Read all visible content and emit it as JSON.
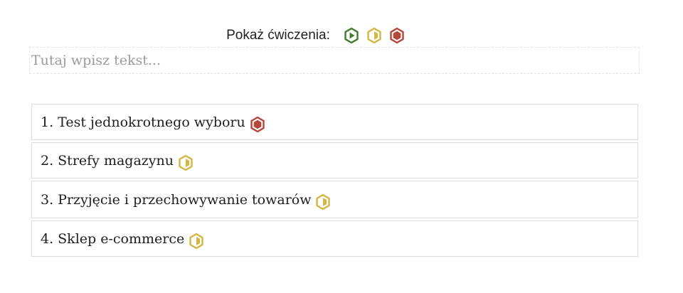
{
  "filter": {
    "label": "Pokaż ćwiczenia:",
    "levels": [
      {
        "id": "easy",
        "icon": "hexagon-play-icon",
        "color": "#3f7d2c"
      },
      {
        "id": "medium",
        "icon": "hexagon-half-icon",
        "color": "#d4b642"
      },
      {
        "id": "hard",
        "icon": "hexagon-filled-icon",
        "color": "#b6463a"
      }
    ]
  },
  "search": {
    "placeholder": "Tutaj wpisz tekst..."
  },
  "exercises": [
    {
      "title": "1. Test jednokrotnego wyboru",
      "difficulty": "hard"
    },
    {
      "title": "2. Strefy magazynu",
      "difficulty": "medium"
    },
    {
      "title": "3. Przyjęcie i przechowywanie towarów",
      "difficulty": "medium"
    },
    {
      "title": "4. Sklep e-commerce",
      "difficulty": "medium"
    }
  ]
}
